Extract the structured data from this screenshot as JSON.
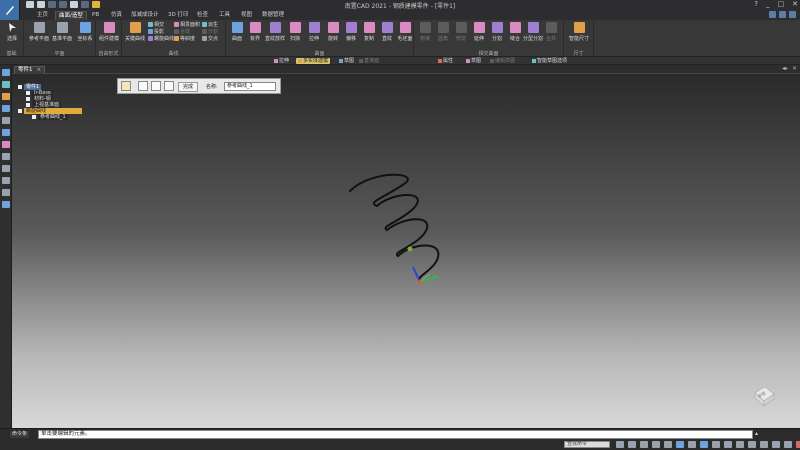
{
  "window": {
    "title": "南置CAD 2021 - 钢质建模零件 - [零件1]",
    "controls": [
      "?",
      "_",
      "□",
      "✕"
    ]
  },
  "tabs": [
    "主页",
    "曲面/造型",
    "PB",
    "仿真",
    "加减成设计",
    "3D 打印",
    "检查",
    "工具",
    "视图",
    "数据管理"
  ],
  "active_tab_index": 1,
  "ribbon": {
    "groups": {
      "basic": {
        "label": "基础",
        "select": "选择"
      },
      "plane": {
        "label": "平面",
        "items": [
          "参考平面",
          "基准平面",
          "坐标系"
        ]
      },
      "auto": {
        "label": "自由形式",
        "items": [
          "组件建模"
        ]
      },
      "curve": {
        "label": "曲线",
        "big": "关键曲线",
        "small": [
          "相交",
          "投影",
          "螺旋曲线",
          "相贯面积",
          "合成",
          "等斜度",
          "派生",
          "分割",
          "交点"
        ]
      },
      "surface": {
        "label": "曲面",
        "items": [
          "曲面",
          "有界",
          "直纹放样",
          "扫掠",
          "拉伸",
          "旋转",
          "偏移",
          "复制",
          "直纹",
          "毛坯面"
        ]
      },
      "trim": {
        "label": "相交曲面",
        "items": [
          "桥接",
          "圆角",
          "修剪",
          "延伸",
          "分割",
          "缝合",
          "分型分割",
          "合并"
        ]
      },
      "size": {
        "label": "尺寸",
        "items": [
          "智能尺寸"
        ]
      }
    }
  },
  "subbar": {
    "items": [
      "拉伸",
      "多实体建模",
      "草图",
      "基准面",
      "属性",
      "草图",
      "编辑草图",
      "智能草图选项"
    ],
    "highlight_index": 1
  },
  "document_tab": {
    "label": "零件1",
    "close": "×"
  },
  "tree": {
    "nodes": [
      {
        "label": "零件1",
        "style": "box"
      },
      {
        "label": "Ir-Base",
        "style": "dark"
      },
      {
        "label": "材料-钢",
        "style": "dark"
      },
      {
        "label": "上视基准面",
        "style": "dark"
      },
      {
        "label": "螺旋曲线",
        "style": "sel"
      },
      {
        "label": "参考曲线_1",
        "style": "dark"
      }
    ]
  },
  "popup": {
    "done_label": "完成",
    "name_label": "名称:",
    "name_value": "参考曲线_1"
  },
  "viewcube_label": "前视",
  "command": {
    "label": "命令条",
    "prompt": "单击要编辑的元素。"
  },
  "status": {
    "search_placeholder": "查找命令"
  },
  "colors": {
    "highlight": "#e4a93b",
    "accent": "#3c6ea8",
    "curve": "#111111"
  }
}
